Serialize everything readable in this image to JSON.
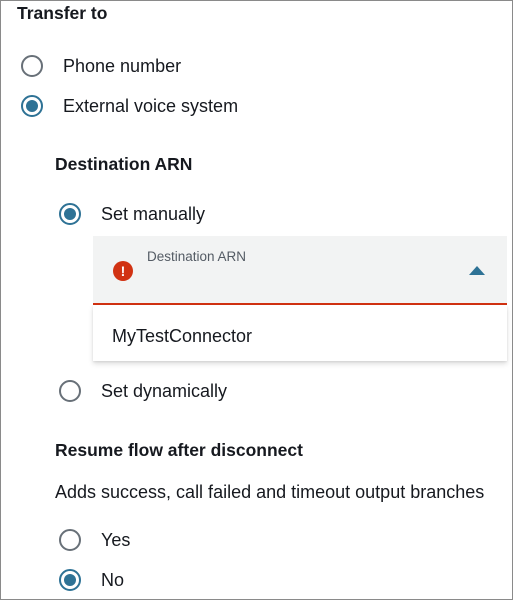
{
  "transfer": {
    "heading": "Transfer to",
    "options": [
      {
        "label": "Phone number",
        "checked": false
      },
      {
        "label": "External voice system",
        "checked": true
      }
    ]
  },
  "destination": {
    "heading": "Destination ARN",
    "options": [
      {
        "label": "Set manually",
        "checked": true
      },
      {
        "label": "Set dynamically",
        "checked": false
      }
    ],
    "select": {
      "label": "Destination ARN",
      "error_icon": "!",
      "state": "error",
      "expanded": true
    },
    "dropdown_options": [
      {
        "label": "MyTestConnector"
      }
    ]
  },
  "resume": {
    "heading": "Resume flow after disconnect",
    "description": "Adds success, call failed and timeout output branches",
    "options": [
      {
        "label": "Yes",
        "checked": false
      },
      {
        "label": "No",
        "checked": true
      }
    ]
  },
  "colors": {
    "accent": "#2e7295",
    "error": "#d13212",
    "field_background": "#f2f3f3"
  },
  "icons": {
    "error": "error-icon",
    "caret": "caret-up-icon"
  }
}
